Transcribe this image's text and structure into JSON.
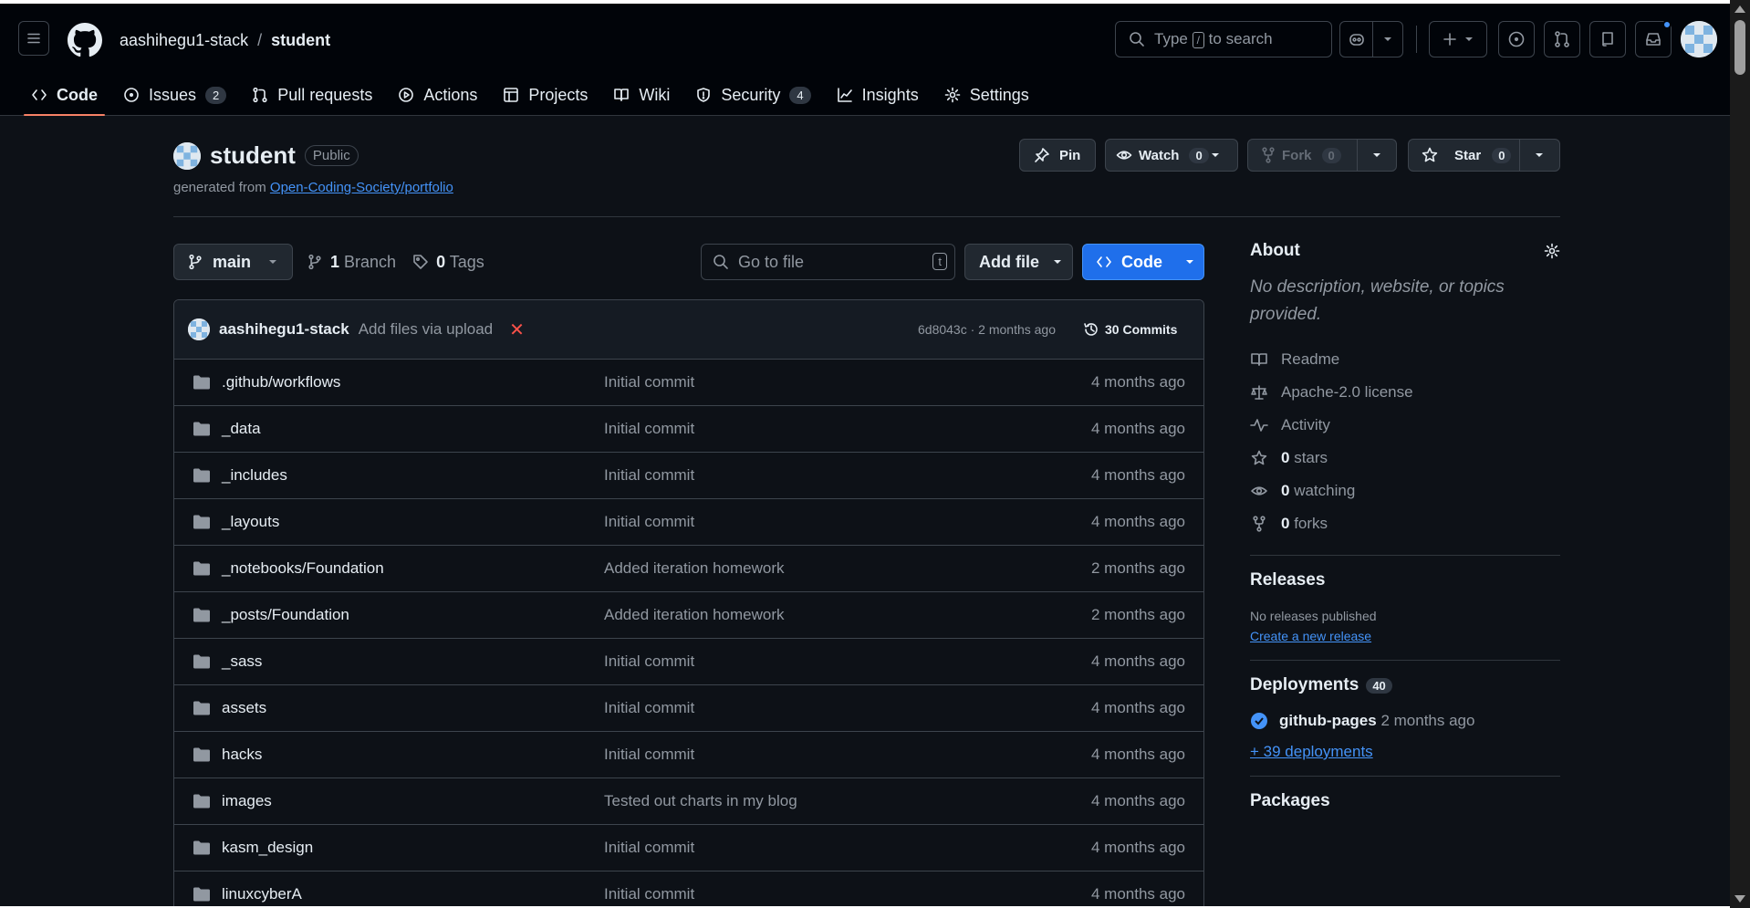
{
  "header": {
    "owner": "aashihegu1-stack",
    "separator": "/",
    "repo": "student",
    "search_prefix": "Type",
    "search_key": "/",
    "search_suffix": "to search"
  },
  "tabs": [
    {
      "label": "Code",
      "icon": "code-icon",
      "count": ""
    },
    {
      "label": "Issues",
      "icon": "issue-icon",
      "count": "2"
    },
    {
      "label": "Pull requests",
      "icon": "pull-request-icon",
      "count": ""
    },
    {
      "label": "Actions",
      "icon": "play-icon",
      "count": ""
    },
    {
      "label": "Projects",
      "icon": "table-icon",
      "count": ""
    },
    {
      "label": "Wiki",
      "icon": "book-icon",
      "count": ""
    },
    {
      "label": "Security",
      "icon": "shield-icon",
      "count": "4"
    },
    {
      "label": "Insights",
      "icon": "graph-icon",
      "count": ""
    },
    {
      "label": "Settings",
      "icon": "gear-icon",
      "count": ""
    }
  ],
  "repo": {
    "name": "student",
    "visibility": "Public",
    "generated_prefix": "generated from",
    "generated_link": "Open-Coding-Society/portfolio"
  },
  "actions": {
    "pin": "Pin",
    "watch": "Watch",
    "watch_count": "0",
    "fork": "Fork",
    "fork_count": "0",
    "star": "Star",
    "star_count": "0"
  },
  "toolbar": {
    "branch": "main",
    "branch_count": "1",
    "branch_label": "Branch",
    "tag_count": "0",
    "tag_label": "Tags",
    "goto_placeholder": "Go to file",
    "goto_key": "t",
    "add_file": "Add file",
    "code": "Code"
  },
  "commit": {
    "author": "aashihegu1-stack",
    "message": "Add files via upload",
    "status": "✕",
    "hash_time": "6d8043c · 2 months ago",
    "commits": "30 Commits"
  },
  "files": [
    {
      "name": ".github/workflows",
      "message": "Initial commit",
      "age": "4 months ago"
    },
    {
      "name": "_data",
      "message": "Initial commit",
      "age": "4 months ago"
    },
    {
      "name": "_includes",
      "message": "Initial commit",
      "age": "4 months ago"
    },
    {
      "name": "_layouts",
      "message": "Initial commit",
      "age": "4 months ago"
    },
    {
      "name": "_notebooks/Foundation",
      "message": "Added iteration homework",
      "age": "2 months ago"
    },
    {
      "name": "_posts/Foundation",
      "message": "Added iteration homework",
      "age": "2 months ago"
    },
    {
      "name": "_sass",
      "message": "Initial commit",
      "age": "4 months ago"
    },
    {
      "name": "assets",
      "message": "Initial commit",
      "age": "4 months ago"
    },
    {
      "name": "hacks",
      "message": "Initial commit",
      "age": "4 months ago"
    },
    {
      "name": "images",
      "message": "Tested out charts in my blog",
      "age": "4 months ago"
    },
    {
      "name": "kasm_design",
      "message": "Initial commit",
      "age": "4 months ago"
    },
    {
      "name": "linuxcyberA",
      "message": "Initial commit",
      "age": "4 months ago"
    }
  ],
  "about": {
    "title": "About",
    "description": "No description, website, or topics provided.",
    "readme": "Readme",
    "license": "Apache-2.0 license",
    "activity": "Activity",
    "stars_count": "0",
    "stars_label": "stars",
    "watching_count": "0",
    "watching_label": "watching",
    "forks_count": "0",
    "forks_label": "forks"
  },
  "releases": {
    "title": "Releases",
    "none": "No releases published",
    "create": "Create a new release"
  },
  "deployments": {
    "title": "Deployments",
    "count": "40",
    "env": "github-pages",
    "time": "2 months ago",
    "more": "+ 39 deployments"
  },
  "packages": {
    "title": "Packages"
  },
  "colors": {
    "bg": "#0d1117",
    "header_bg": "#010409",
    "accent": "#1f6feb",
    "link": "#4493f8",
    "tab_underline": "#f78166",
    "error": "#f85149"
  }
}
